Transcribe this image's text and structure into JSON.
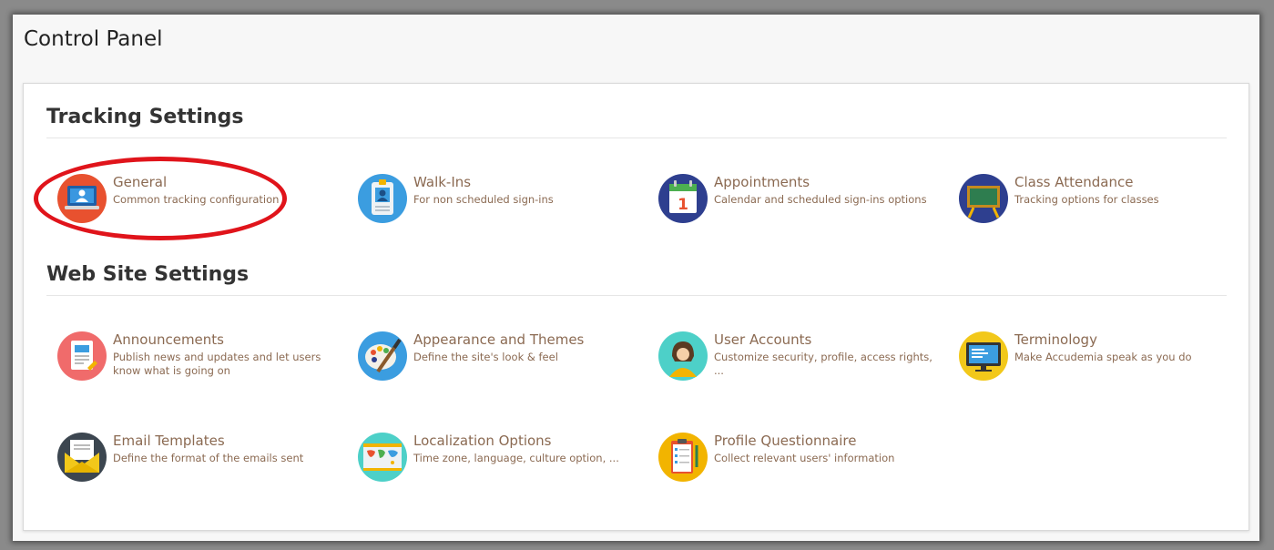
{
  "page": {
    "title": "Control Panel"
  },
  "sections": [
    {
      "title": "Tracking Settings",
      "items": [
        {
          "title": "General",
          "description": "Common tracking configuration",
          "icon": "monitor-user-icon"
        },
        {
          "title": "Walk-Ins",
          "description": "For non scheduled sign-ins",
          "icon": "id-badge-icon"
        },
        {
          "title": "Appointments",
          "description": "Calendar and scheduled sign-ins options",
          "icon": "calendar-icon"
        },
        {
          "title": "Class Attendance",
          "description": "Tracking options for classes",
          "icon": "chalkboard-icon"
        }
      ]
    },
    {
      "title": "Web Site Settings",
      "items": [
        {
          "title": "Announcements",
          "description": "Publish news and updates and let users know what is going on",
          "icon": "document-icon"
        },
        {
          "title": "Appearance and Themes",
          "description": "Define the site's look & feel",
          "icon": "palette-icon"
        },
        {
          "title": "User Accounts",
          "description": "Customize security, profile, access rights, ...",
          "icon": "user-avatar-icon"
        },
        {
          "title": "Terminology",
          "description": "Make Accudemia speak as you do",
          "icon": "screen-text-icon"
        },
        {
          "title": "Email Templates",
          "description": "Define the format of the emails sent",
          "icon": "envelope-icon"
        },
        {
          "title": "Localization Options",
          "description": "Time zone, language, culture option, ...",
          "icon": "world-map-icon"
        },
        {
          "title": "Profile Questionnaire",
          "description": "Collect relevant users' information",
          "icon": "clipboard-icon"
        }
      ]
    }
  ],
  "colors": {
    "link": "#8b6a52",
    "highlight_circle": "#e0141b"
  }
}
